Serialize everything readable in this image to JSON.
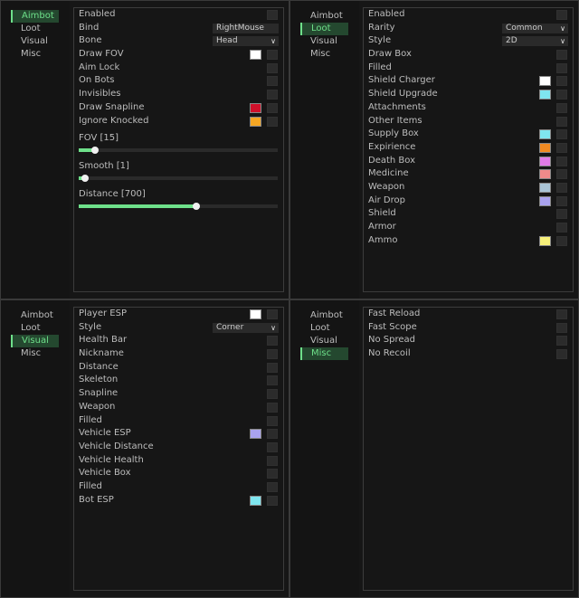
{
  "tabs": [
    "Aimbot",
    "Loot",
    "Visual",
    "Misc"
  ],
  "aimbot": {
    "active_tab": 0,
    "rows": [
      {
        "label": "Enabled",
        "kind": "check"
      },
      {
        "label": "Bind",
        "kind": "field",
        "value": "RightMouse"
      },
      {
        "label": "Bone",
        "kind": "dropdown",
        "value": "Head"
      },
      {
        "label": "Draw FOV",
        "kind": "color",
        "color": "#ffffff"
      },
      {
        "label": "Aim Lock",
        "kind": "check"
      },
      {
        "label": "On Bots",
        "kind": "check"
      },
      {
        "label": "Invisibles",
        "kind": "check"
      },
      {
        "label": "Draw Snapline",
        "kind": "color",
        "color": "#d0102a"
      },
      {
        "label": "Ignore Knocked",
        "kind": "color",
        "color": "#f5a623"
      }
    ],
    "sliders": [
      {
        "label": "FOV [15]",
        "fraction": 0.08
      },
      {
        "label": "Smooth [1]",
        "fraction": 0.03
      },
      {
        "label": "Distance [700]",
        "fraction": 0.59
      }
    ]
  },
  "loot": {
    "active_tab": 1,
    "rows": [
      {
        "label": "Enabled",
        "kind": "check"
      },
      {
        "label": "Rarity",
        "kind": "dropdown",
        "value": "Common"
      },
      {
        "label": "Style",
        "kind": "dropdown",
        "value": "2D"
      },
      {
        "label": "Draw Box",
        "kind": "check"
      },
      {
        "label": "Filled",
        "kind": "check"
      },
      {
        "label": "Shield Charger",
        "kind": "color",
        "color": "#ffffff"
      },
      {
        "label": "Shield Upgrade",
        "kind": "color",
        "color": "#7fe6ef"
      },
      {
        "label": "Attachments",
        "kind": "check"
      },
      {
        "label": "Other Items",
        "kind": "check"
      },
      {
        "label": "Supply Box",
        "kind": "color",
        "color": "#7fe6ef"
      },
      {
        "label": "Expirience",
        "kind": "color",
        "color": "#f08a22"
      },
      {
        "label": "Death Box",
        "kind": "color",
        "color": "#e07be6"
      },
      {
        "label": "Medicine",
        "kind": "color",
        "color": "#ef8a8a"
      },
      {
        "label": "Weapon",
        "kind": "color",
        "color": "#a9c4d6"
      },
      {
        "label": "Air Drop",
        "kind": "color",
        "color": "#a9a2ee"
      },
      {
        "label": "Shield",
        "kind": "check"
      },
      {
        "label": "Armor",
        "kind": "check"
      },
      {
        "label": "Ammo",
        "kind": "color",
        "color": "#f6f07a"
      }
    ]
  },
  "visual": {
    "active_tab": 2,
    "rows": [
      {
        "label": "Player ESP",
        "kind": "color",
        "color": "#ffffff"
      },
      {
        "label": "Style",
        "kind": "dropdown",
        "value": "Corner"
      },
      {
        "label": "Health Bar",
        "kind": "check"
      },
      {
        "label": "Nickname",
        "kind": "check"
      },
      {
        "label": "Distance",
        "kind": "check"
      },
      {
        "label": "Skeleton",
        "kind": "check"
      },
      {
        "label": "Snapline",
        "kind": "check"
      },
      {
        "label": "Weapon",
        "kind": "check"
      },
      {
        "label": "Filled",
        "kind": "check"
      },
      {
        "label": "Vehicle ESP",
        "kind": "color",
        "color": "#a9a2ee"
      },
      {
        "label": "Vehicle Distance",
        "kind": "check"
      },
      {
        "label": "Vehicle Health",
        "kind": "check"
      },
      {
        "label": "Vehicle Box",
        "kind": "check"
      },
      {
        "label": "Filled",
        "kind": "check"
      },
      {
        "label": "Bot ESP",
        "kind": "color",
        "color": "#7fe6ef"
      }
    ]
  },
  "misc": {
    "active_tab": 3,
    "rows": [
      {
        "label": "Fast Reload",
        "kind": "check"
      },
      {
        "label": "Fast Scope",
        "kind": "check"
      },
      {
        "label": "No Spread",
        "kind": "check"
      },
      {
        "label": "No Recoil",
        "kind": "check"
      }
    ]
  }
}
